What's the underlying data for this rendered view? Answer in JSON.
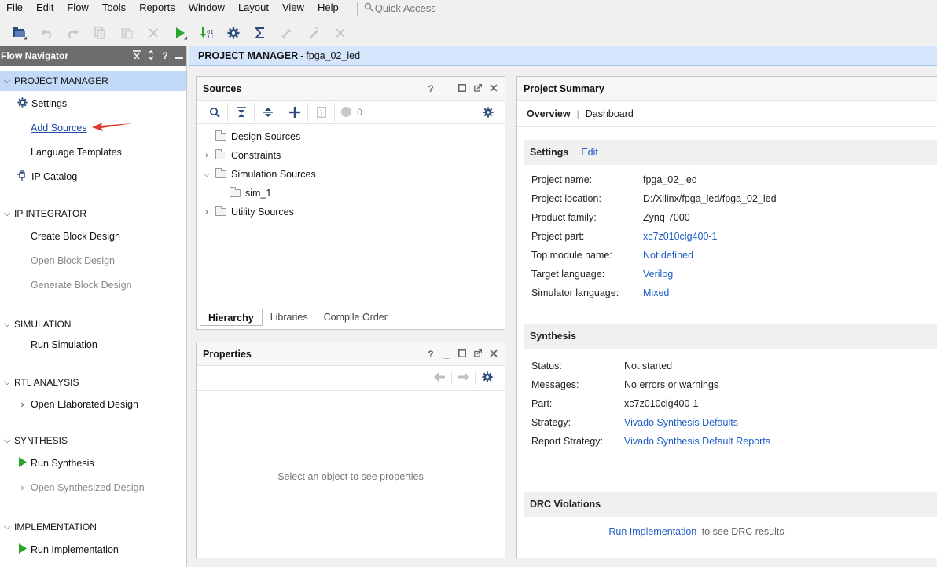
{
  "menubar": {
    "items": [
      "File",
      "Edit",
      "Flow",
      "Tools",
      "Reports",
      "Window",
      "Layout",
      "View",
      "Help"
    ],
    "quick_access_placeholder": "Quick Access"
  },
  "toolbar": {
    "icons": [
      "open-project-icon",
      "undo-icon",
      "redo-icon",
      "copy-icon",
      "paste-icon",
      "delete-icon",
      "run-icon",
      "program-download-icon",
      "settings-icon",
      "sigma-icon",
      "tool-a-icon",
      "tool-b-icon",
      "tool-c-icon"
    ]
  },
  "flow_nav": {
    "title": "Flow Navigator",
    "project_manager": {
      "label": "PROJECT MANAGER",
      "items": [
        "Settings",
        "Add Sources",
        "Language Templates",
        "IP Catalog"
      ]
    },
    "ip_integrator": {
      "label": "IP INTEGRATOR",
      "items": [
        "Create Block Design",
        "Open Block Design",
        "Generate Block Design"
      ]
    },
    "simulation": {
      "label": "SIMULATION",
      "items": [
        "Run Simulation"
      ]
    },
    "rtl_analysis": {
      "label": "RTL ANALYSIS",
      "items": [
        "Open Elaborated Design"
      ]
    },
    "synthesis": {
      "label": "SYNTHESIS",
      "items": [
        "Run Synthesis",
        "Open Synthesized Design"
      ]
    },
    "implementation": {
      "label": "IMPLEMENTATION",
      "items": [
        "Run Implementation"
      ]
    }
  },
  "project_manager_title": {
    "label": "PROJECT MANAGER",
    "project": "fpga_02_led"
  },
  "sources": {
    "title": "Sources",
    "count": "0",
    "tree": [
      "Design Sources",
      "Constraints",
      "Simulation Sources",
      "sim_1",
      "Utility Sources"
    ],
    "tabs": [
      "Hierarchy",
      "Libraries",
      "Compile Order"
    ]
  },
  "properties": {
    "title": "Properties",
    "empty_text": "Select an object to see properties"
  },
  "summary": {
    "title": "Project Summary",
    "tabs": [
      "Overview",
      "Dashboard"
    ],
    "settings": {
      "title": "Settings",
      "edit": "Edit",
      "rows": [
        {
          "label": "Project name:",
          "value": "fpga_02_led"
        },
        {
          "label": "Project location:",
          "value": "D:/Xilinx/fpga_led/fpga_02_led"
        },
        {
          "label": "Product family:",
          "value": "Zynq-7000"
        },
        {
          "label": "Project part:",
          "value": "xc7z010clg400-1"
        },
        {
          "label": "Top module name:",
          "value": "Not defined"
        },
        {
          "label": "Target language:",
          "value": "Verilog"
        },
        {
          "label": "Simulator language:",
          "value": "Mixed"
        }
      ]
    },
    "synthesis": {
      "title": "Synthesis",
      "rows": [
        {
          "label": "Status:",
          "value": "Not started"
        },
        {
          "label": "Messages:",
          "value": "No errors or warnings"
        },
        {
          "label": "Part:",
          "value": "xc7z010clg400-1"
        },
        {
          "label": "Strategy:",
          "value": "Vivado Synthesis Defaults"
        },
        {
          "label": "Report Strategy:",
          "value": "Vivado Synthesis Default Reports"
        }
      ]
    },
    "drc": {
      "title": "DRC Violations",
      "link": "Run Implementation",
      "text": "to see DRC results"
    }
  },
  "colors": {
    "link": "#1f5fc4",
    "nav_active": "#c2d9f7",
    "header_gray": "#6d6d6d",
    "run_green": "#2aa52a",
    "arrow_red": "#e0362a"
  }
}
